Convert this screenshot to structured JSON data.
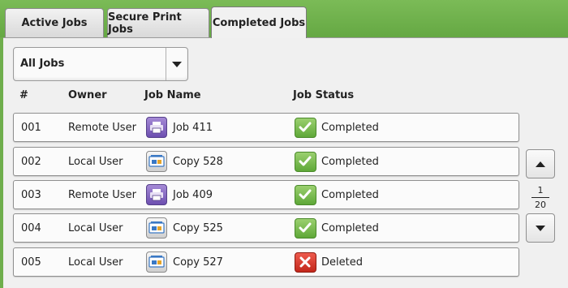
{
  "tabs": [
    {
      "label": "Active Jobs",
      "active": false
    },
    {
      "label": "Secure Print Jobs",
      "active": false
    },
    {
      "label": "Completed Jobs",
      "active": true
    }
  ],
  "filter": {
    "selected": "All Jobs"
  },
  "columns": {
    "num": "#",
    "owner": "Owner",
    "job_name": "Job Name",
    "status": "Job Status"
  },
  "rows": [
    {
      "num": "001",
      "owner": "Remote User",
      "job_icon": "print-job-icon",
      "job_name": "Job 411",
      "status_icon": "check-icon",
      "status": "Completed"
    },
    {
      "num": "002",
      "owner": "Local User",
      "job_icon": "copy-job-icon",
      "job_name": "Copy 528",
      "status_icon": "check-icon",
      "status": "Completed"
    },
    {
      "num": "003",
      "owner": "Remote User",
      "job_icon": "print-job-icon",
      "job_name": "Job 409",
      "status_icon": "check-icon",
      "status": "Completed"
    },
    {
      "num": "004",
      "owner": "Local User",
      "job_icon": "copy-job-icon",
      "job_name": "Copy 525",
      "status_icon": "check-icon",
      "status": "Completed"
    },
    {
      "num": "005",
      "owner": "Local User",
      "job_icon": "copy-job-icon",
      "job_name": "Copy 527",
      "status_icon": "delete-icon",
      "status": "Deleted"
    }
  ],
  "pagination": {
    "current": "1",
    "total": "20"
  },
  "colors": {
    "accent_green": "#6fae4c",
    "ok_green": "#5ea838",
    "deleted_red": "#c2271b",
    "print_purple": "#6d4fb0"
  }
}
